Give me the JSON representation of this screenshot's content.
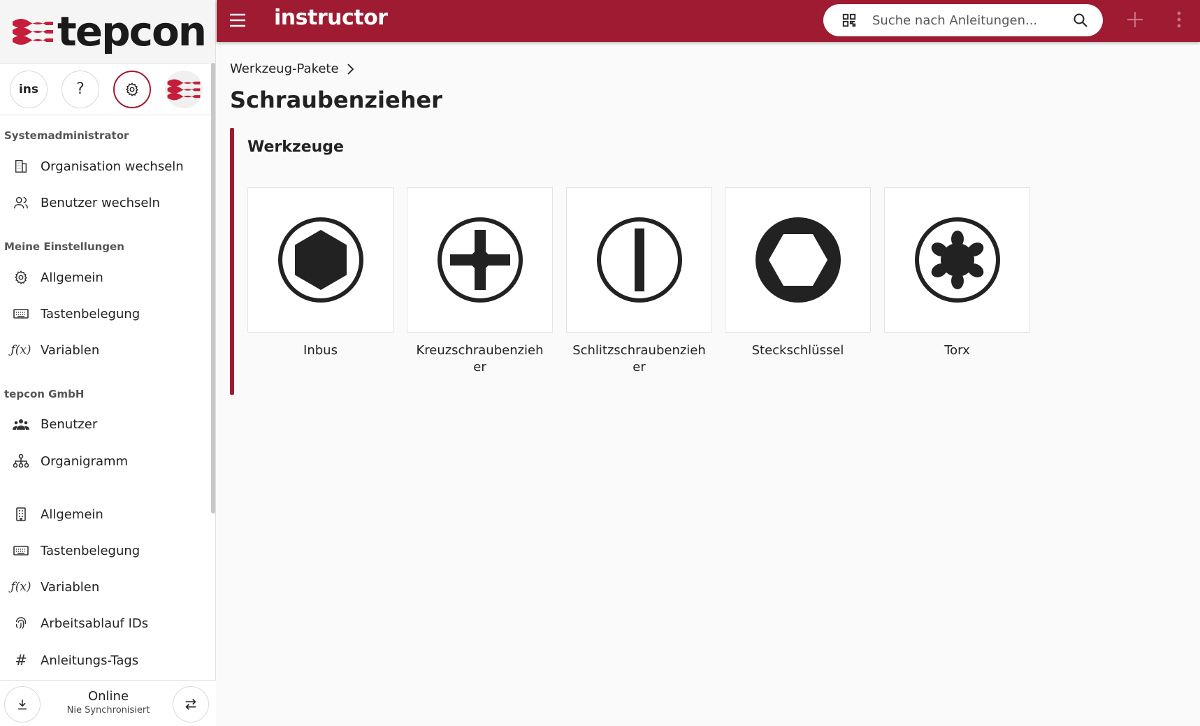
{
  "brand": {
    "company_logo_text": "tepcon",
    "app_name": "instructor",
    "accent_color": "#9e1b32"
  },
  "header": {
    "search_placeholder": "Suche nach Anleitungen...",
    "icons": [
      "menu-icon",
      "qr-code-icon",
      "search-icon",
      "plus-icon",
      "more-vert-icon"
    ]
  },
  "sidebar": {
    "quick_buttons": [
      {
        "name": "instructor-app",
        "label": "ins"
      },
      {
        "name": "help",
        "label": "?"
      },
      {
        "name": "settings",
        "icon": "gear-icon"
      },
      {
        "name": "organization-logo",
        "icon": "tepcon-logo"
      }
    ],
    "sections": [
      {
        "title": "Systemadministrator",
        "items": [
          {
            "label": "Organisation wechseln",
            "icon": "building-icon"
          },
          {
            "label": "Benutzer wechseln",
            "icon": "users-icon"
          }
        ]
      },
      {
        "title": "Meine Einstellungen",
        "items": [
          {
            "label": "Allgemein",
            "icon": "gear-icon"
          },
          {
            "label": "Tastenbelegung",
            "icon": "keyboard-icon"
          },
          {
            "label": "Variablen",
            "icon": "function-icon"
          }
        ]
      },
      {
        "title": "tepcon GmbH",
        "items": [
          {
            "label": "Benutzer",
            "icon": "group-icon"
          },
          {
            "label": "Organigramm",
            "icon": "org-chart-icon"
          },
          {
            "label": "Allgemein",
            "icon": "building-small-icon"
          },
          {
            "label": "Tastenbelegung",
            "icon": "keyboard-icon"
          },
          {
            "label": "Variablen",
            "icon": "function-icon"
          },
          {
            "label": "Arbeitsablauf IDs",
            "icon": "fingerprint-icon"
          },
          {
            "label": "Anleitungs-Tags",
            "icon": "hash-icon"
          }
        ]
      }
    ],
    "sync": {
      "status": "Online",
      "detail": "Nie Synchronisiert"
    }
  },
  "main": {
    "breadcrumb": [
      "Werkzeug-Pakete"
    ],
    "title": "Schraubenzieher",
    "group_title": "Werkzeuge",
    "tools": [
      {
        "label": "Inbus",
        "icon": "hex-socket-icon"
      },
      {
        "label": "Kreuzschraubenzieher",
        "icon": "phillips-icon"
      },
      {
        "label": "Schlitzschraubenzieher",
        "icon": "slotted-icon"
      },
      {
        "label": "Steckschlüssel",
        "icon": "socket-wrench-icon"
      },
      {
        "label": "Torx",
        "icon": "torx-icon"
      }
    ]
  }
}
